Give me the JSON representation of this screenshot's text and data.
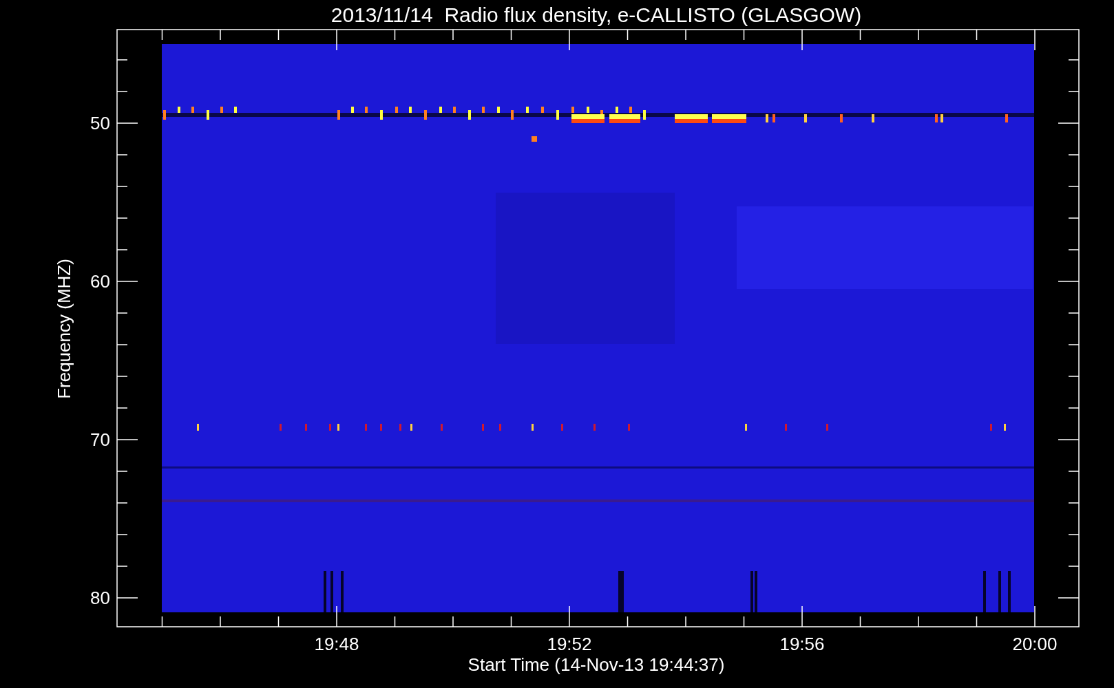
{
  "title": "2013/11/14  Radio flux density, e-CALLISTO (GLASGOW)",
  "ylabel": "Frequency (MHZ)",
  "xlabel": "Start Time (14-Nov-13 19:44:37)",
  "yticks": [
    "50",
    "60",
    "70",
    "80"
  ],
  "xticks": [
    "19:48",
    "19:52",
    "19:56",
    "20:00"
  ]
}
